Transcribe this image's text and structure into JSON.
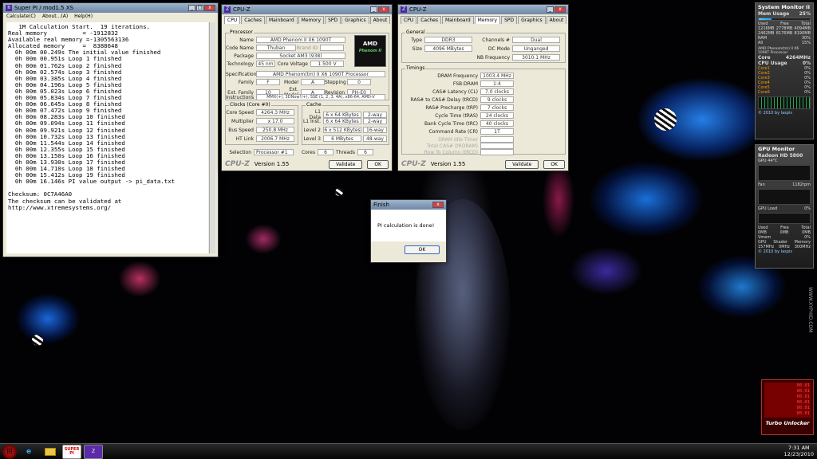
{
  "superpi": {
    "title": "Super PI / mod1.5 XS",
    "menu": [
      "Calculate(C)",
      "About...(A)",
      "Help(H)"
    ],
    "console": "   1M Calculation Start.  19 iterations.\nReal memory          = -1912832\nAvailable real memory =-1305563136\nAllocated memory     =  8388648\n  0h 00m 00.249s The initial value finished\n  0h 00m 00.951s Loop 1 finished\n  0h 00m 01.762s Loop 2 finished\n  0h 00m 02.574s Loop 3 finished\n  0h 00m 03.385s Loop 4 finished\n  0h 00m 04.196s Loop 5 finished\n  0h 00m 05.023s Loop 6 finished\n  0h 00m 05.834s Loop 7 finished\n  0h 00m 06.645s Loop 8 finished\n  0h 00m 07.472s Loop 9 finished\n  0h 00m 08.283s Loop 10 finished\n  0h 00m 09.094s Loop 11 finished\n  0h 00m 09.921s Loop 12 finished\n  0h 00m 10.732s Loop 13 finished\n  0h 00m 11.544s Loop 14 finished\n  0h 00m 12.355s Loop 15 finished\n  0h 00m 13.150s Loop 16 finished\n  0h 00m 13.930s Loop 17 finished\n  0h 00m 14.710s Loop 18 finished\n  0h 00m 15.412s Loop 19 finished\n  0h 00m 16.146s PI value output -> pi_data.txt\n\nChecksum: 0C7A46A0\nThe checksum can be validated at\nhttp://www.xtremesystems.org/"
  },
  "cpuz1": {
    "title": "CPU-Z",
    "tabs": [
      "CPU",
      "Caches",
      "Mainboard",
      "Memory",
      "SPD",
      "Graphics",
      "About"
    ],
    "processor_group": "Processor",
    "name_label": "Name",
    "name": "AMD Phenom II X6 1090T",
    "codename_label": "Code Name",
    "codename": "Thuban",
    "brandid_label": "Brand ID",
    "package_label": "Package",
    "package": "Socket AM3 (938)",
    "tech_label": "Technology",
    "tech": "45 nm",
    "voltage_label": "Core Voltage",
    "voltage": "1.500 V",
    "spec_label": "Specification",
    "spec": "AMD Phenom(tm) II X6 1090T Processor",
    "family_label": "Family",
    "family": "F",
    "model_label": "Model",
    "model": "A",
    "stepping_label": "Stepping",
    "stepping": "0",
    "extfamily_label": "Ext. Family",
    "extfamily": "10",
    "extmodel_label": "Ext. Model",
    "extmodel": "A",
    "revision_label": "Revision",
    "revision": "PH-E0",
    "instr_label": "Instructions",
    "instr": "MMX(+), 3DNow!(+), SSE (1, 2, 3, 4A), x86-64, AMD-V",
    "clocks_group": "Clocks (Core #0)",
    "corespeed_label": "Core Speed",
    "corespeed": "4264.3 MHz",
    "mult_label": "Multiplier",
    "mult": "x 17.0",
    "bus_label": "Bus Speed",
    "bus": "250.8 MHz",
    "ht_label": "HT Link",
    "ht": "2006.7 MHz",
    "cache_group": "Cache",
    "l1d_label": "L1 Data",
    "l1d": "6 x 64 KBytes",
    "l1d_way": "2-way",
    "l1i_label": "L1 Inst.",
    "l1i": "6 x 64 KBytes",
    "l1i_way": "2-way",
    "l2_label": "Level 2",
    "l2": "6 x 512 KBytes",
    "l2_way": "16-way",
    "l3_label": "Level 3",
    "l3": "6 MBytes",
    "l3_way": "48-way",
    "selection_label": "Selection",
    "selection": "Processor #1",
    "cores_label": "Cores",
    "cores": "6",
    "threads_label": "Threads",
    "threads": "6",
    "logo": "CPU-Z",
    "version": "Version 1.55",
    "validate": "Validate",
    "ok": "OK",
    "amd_logo": "AMD",
    "phenom_logo": "Phenom II"
  },
  "cpuz2": {
    "title": "CPU-Z",
    "tabs": [
      "CPU",
      "Caches",
      "Mainboard",
      "Memory",
      "SPD",
      "Graphics",
      "About"
    ],
    "general_group": "General",
    "type_label": "Type",
    "type": "DDR3",
    "channels_label": "Channels #",
    "channels": "Dual",
    "size_label": "Size",
    "size": "4096 MBytes",
    "dcmode_label": "DC Mode",
    "dcmode": "Unganged",
    "nbfreq_label": "NB Frequency",
    "nbfreq": "3010.1 MHz",
    "timings_group": "Timings",
    "dram_label": "DRAM Frequency",
    "dram": "1003.4 MHz",
    "fsb_label": "FSB:DRAM",
    "fsb": "1:4",
    "cl_label": "CAS# Latency (CL)",
    "cl": "7.0 clocks",
    "trcd_label": "RAS# to CAS# Delay (tRCD)",
    "trcd": "9 clocks",
    "trp_label": "RAS# Precharge (tRP)",
    "trp": "7 clocks",
    "tras_label": "Cycle Time (tRAS)",
    "tras": "24 clocks",
    "trc_label": "Bank Cycle Time (tRC)",
    "trc": "40 clocks",
    "cr_label": "Command Rate (CR)",
    "cr": "1T",
    "idle_label": "DRAM Idle Timer",
    "total_label": "Total CAS# (tRDRAM)",
    "rowcol_label": "Row To Column (tRCD)",
    "logo": "CPU-Z",
    "version": "Version 1.55",
    "validate": "Validate",
    "ok": "OK"
  },
  "dialog": {
    "title": "Finish",
    "message": "PI calculation is done!",
    "ok": "OK"
  },
  "sysmon": {
    "title": "System Monitor II",
    "mem_label": "Mem Usage",
    "mem_pct": "25%",
    "mem_fraction": 0.25,
    "used_h": "Used",
    "free_h": "Free",
    "total_h": "Total",
    "r1": [
      "1216MB",
      "2778MB",
      "4094MB"
    ],
    "r2": [
      "2462MB",
      "8176MB",
      "8190MB"
    ],
    "ram_label": "RAM",
    "ram_pct": "30%",
    "all_label": "All",
    "all_pct": "15%",
    "cpu_name": "AMD Phenom(tm) II X6 1090T Processor",
    "core_label": "Core",
    "core_freq": "4264MHz",
    "cpu_usage_label": "CPU Usage",
    "cpu_usage": "0%",
    "cores": [
      {
        "name": "Core1",
        "val": "0%"
      },
      {
        "name": "Core2",
        "val": "0%"
      },
      {
        "name": "Core3",
        "val": "0%"
      },
      {
        "name": "Core4",
        "val": "0%"
      },
      {
        "name": "Core5",
        "val": "0%"
      },
      {
        "name": "Core6",
        "val": "0%"
      }
    ],
    "credit": "© 2010 by Iaspis"
  },
  "gpumon": {
    "title": "GPU Monitor",
    "gpu_name": "Radeon HD 5800",
    "gpu_temp": "GPU 44°C",
    "fan_label": "Fan",
    "fan": "1182rpm",
    "gpu_load_label": "GPU Load",
    "gpu_load": "0%",
    "used_h": "Used",
    "free_h": "Free",
    "total_h": "Total",
    "mem": [
      "0MB",
      "0MB",
      "0MB"
    ],
    "vmem_label": "Vmem",
    "vmem": "0%",
    "clk_h": [
      "GPU",
      "Shader",
      "Memory"
    ],
    "clk": [
      "157MHz",
      "0MHz",
      "300MHz"
    ],
    "credit": "© 2010 by Iaspis"
  },
  "turbo": {
    "label": "Turbo Unlocker",
    "values": [
      "00.01",
      "00.01",
      "00.01",
      "00.01",
      "00.01",
      "00.01"
    ]
  },
  "side_text": "WWW.XYPHID.COM",
  "clock": {
    "time": "7:31 AM",
    "date": "12/23/2010"
  },
  "taskbar": {
    "icons": [
      "windows-start-icon",
      "ie-icon",
      "explorer-icon",
      "superpi-icon",
      "cpuz-icon"
    ],
    "superpi_label": "SUPER PI"
  }
}
